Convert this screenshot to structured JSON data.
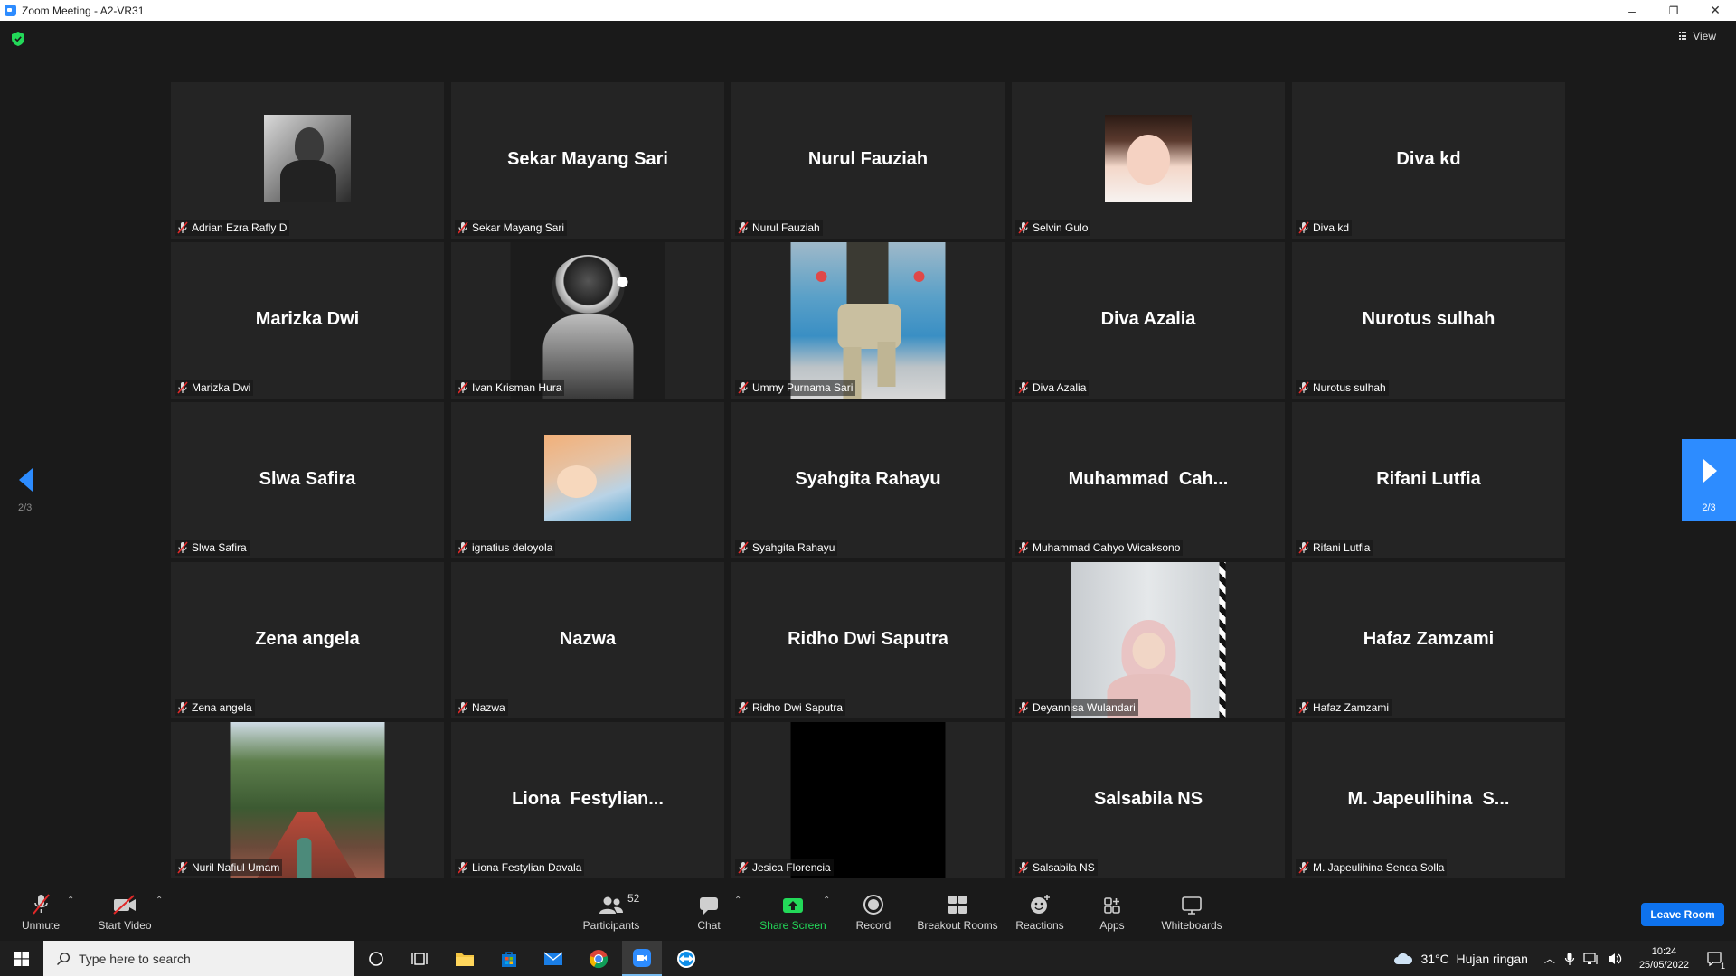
{
  "window": {
    "title": "Zoom Meeting - A2-VR31",
    "minimize": "–",
    "restore": "❐",
    "close": "✕"
  },
  "meeting": {
    "view_label": "View",
    "page_indicator": "2/3",
    "participants": [
      {
        "label": "Adrian Ezra Rafly D",
        "display": "",
        "media": "photo-man"
      },
      {
        "label": "Sekar Mayang Sari",
        "display": "Sekar Mayang Sari",
        "media": ""
      },
      {
        "label": "Nurul Fauziah",
        "display": "Nurul Fauziah",
        "media": ""
      },
      {
        "label": "Selvin Gulo",
        "display": "",
        "media": "photo-girl"
      },
      {
        "label": "Diva kd",
        "display": "Diva kd",
        "media": ""
      },
      {
        "label": "Marizka Dwi",
        "display": "Marizka Dwi",
        "media": ""
      },
      {
        "label": "Ivan Krisman Hura",
        "display": "",
        "media": "video-astronaut"
      },
      {
        "label": "Ummy Purnama Sari",
        "display": "",
        "media": "video-train"
      },
      {
        "label": "Diva Azalia",
        "display": "Diva Azalia",
        "media": ""
      },
      {
        "label": "Nurotus sulhah",
        "display": "Nurotus sulhah",
        "media": ""
      },
      {
        "label": "Slwa Safira",
        "display": "Slwa Safira",
        "media": ""
      },
      {
        "label": "ignatius deloyola",
        "display": "",
        "media": "photo-baby"
      },
      {
        "label": "Syahgita Rahayu",
        "display": "Syahgita Rahayu",
        "media": ""
      },
      {
        "label": "Muhammad Cahyo Wicaksono",
        "display": "Muhammad  Cah...",
        "media": ""
      },
      {
        "label": "Rifani Lutfia",
        "display": "Rifani Lutfia",
        "media": ""
      },
      {
        "label": "Zena angela",
        "display": "Zena angela",
        "media": ""
      },
      {
        "label": "Nazwa",
        "display": "Nazwa",
        "media": ""
      },
      {
        "label": "Ridho Dwi Saputra",
        "display": "Ridho Dwi Saputra",
        "media": ""
      },
      {
        "label": "Deyannisa Wulandari",
        "display": "",
        "media": "video-hijab"
      },
      {
        "label": "Hafaz Zamzami",
        "display": "Hafaz Zamzami",
        "media": ""
      },
      {
        "label": "Nuril Nafiul Umam",
        "display": "",
        "media": "video-bridge"
      },
      {
        "label": "Liona Festylian Davala",
        "display": "Liona  Festylian...",
        "media": ""
      },
      {
        "label": "Jesica Florencia",
        "display": "",
        "media": "video-black"
      },
      {
        "label": "Salsabila NS",
        "display": "Salsabila NS",
        "media": ""
      },
      {
        "label": "M. Japeulihina Senda Solla",
        "display": "M. Japeulihina  S...",
        "media": ""
      }
    ]
  },
  "toolbar": {
    "unmute": "Unmute",
    "start_video": "Start Video",
    "participants": "Participants",
    "participants_count": "52",
    "chat": "Chat",
    "share_screen": "Share Screen",
    "record": "Record",
    "breakout_rooms": "Breakout Rooms",
    "reactions": "Reactions",
    "apps": "Apps",
    "whiteboards": "Whiteboards",
    "leave": "Leave Room",
    "share_color": "#23d959",
    "leave_color": "#0e72ed"
  },
  "taskbar": {
    "search_placeholder": "Type here to search",
    "weather": "31°C  Hujan ringan",
    "time": "10:24",
    "date": "25/05/2022",
    "notification_count": "1"
  }
}
